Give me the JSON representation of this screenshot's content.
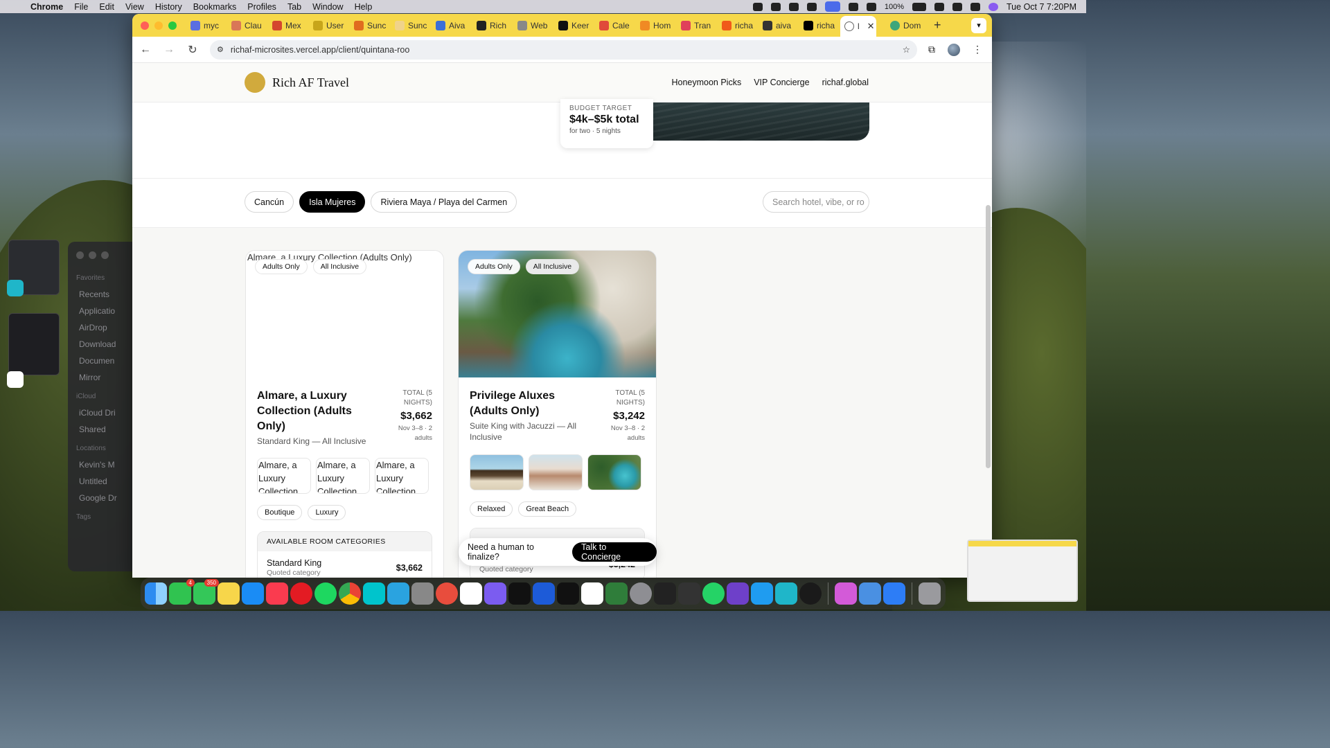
{
  "menubar": {
    "app": "Chrome",
    "items": [
      "File",
      "Edit",
      "View",
      "History",
      "Bookmarks",
      "Profiles",
      "Tab",
      "Window",
      "Help"
    ],
    "battery": "100%",
    "datetime": "Tue Oct 7  7:20PM"
  },
  "finder": {
    "favorites_label": "Favorites",
    "favorites": [
      "Recents",
      "Applicatio",
      "AirDrop",
      "Download",
      "Documen",
      "Mirror"
    ],
    "icloud_label": "iCloud",
    "icloud": [
      "iCloud Dri",
      "Shared"
    ],
    "locations_label": "Locations",
    "locations": [
      "Kevin's M",
      "Untitled",
      "Google Dr"
    ],
    "tags_label": "Tags"
  },
  "browser": {
    "tabs": [
      {
        "label": "myc",
        "color": "#5b6ee1"
      },
      {
        "label": "Clau",
        "color": "#d97757"
      },
      {
        "label": "Mex",
        "color": "#d4462e"
      },
      {
        "label": "User",
        "color": "#c7a51a"
      },
      {
        "label": "Sunc",
        "color": "#e06c1f"
      },
      {
        "label": "Sunc",
        "color": "#f0d38a"
      },
      {
        "label": "Aiva",
        "color": "#3b6fd6"
      },
      {
        "label": "Rich",
        "color": "#222222"
      },
      {
        "label": "Web",
        "color": "#888888"
      },
      {
        "label": "Keer",
        "color": "#111111"
      },
      {
        "label": "Cale",
        "color": "#e04a3a"
      },
      {
        "label": "Hom",
        "color": "#f08a24"
      },
      {
        "label": "Tran",
        "color": "#e0405a"
      },
      {
        "label": "richa",
        "color": "#f05a1a"
      },
      {
        "label": "aiva",
        "color": "#333333"
      },
      {
        "label": "richa",
        "color": "#000000"
      }
    ],
    "active_tab": {
      "label": "l",
      "close": "✕"
    },
    "last_tab": {
      "label": "Dom",
      "color": "#3fa67a"
    },
    "new_tab": "+",
    "url": "richaf-microsites.vercel.app/client/quintana-roo"
  },
  "site": {
    "brand": "Rich AF Travel",
    "nav": [
      "Honeymoon Picks",
      "VIP Concierge",
      "richaf.global"
    ],
    "budget": {
      "label": "BUDGET TARGET",
      "value": "$4k–$5k total",
      "sub": "for two · 5 nights"
    },
    "regions": [
      {
        "label": "Cancún",
        "active": false
      },
      {
        "label": "Isla Mujeres",
        "active": true
      },
      {
        "label": "Riviera Maya / Playa del Carmen",
        "active": false
      }
    ],
    "search_placeholder": "Search hotel, vibe, or ro",
    "hotels": [
      {
        "image_alt": "Almare, a Luxury Collection (Adults Only)",
        "tags": [
          "Adults Only",
          "All Inclusive"
        ],
        "name": "Almare, a Luxury Collection (Adults Only)",
        "room": "Standard King — All Inclusive",
        "price_label": "TOTAL (5 NIGHTS)",
        "price": "$3,662",
        "price_sub": "Nov 3–8 · 2 adults",
        "thumb_alts": [
          "Almare, a Luxury Collection",
          "Almare, a Luxury Collection",
          "Almare, a Luxury Collection"
        ],
        "chips": [
          "Boutique",
          "Luxury"
        ],
        "rooms_header": "AVAILABLE ROOM CATEGORIES",
        "room_row": {
          "name": "Standard King",
          "sub": "Quoted category",
          "price": "$3,662"
        }
      },
      {
        "tags": [
          "Adults Only",
          "All Inclusive"
        ],
        "name": "Privilege Aluxes (Adults Only)",
        "room": "Suite King with Jacuzzi — All Inclusive",
        "price_label": "TOTAL (5 NIGHTS)",
        "price": "$3,242",
        "price_sub": "Nov 3–8 · 2 adults",
        "chips": [
          "Relaxed",
          "Great Beach"
        ],
        "room_row": {
          "sub": "Quoted category",
          "price": "$3,242"
        }
      }
    ],
    "cta": {
      "text": "Need a human to finalize?",
      "button": "Talk to Concierge"
    }
  },
  "dock": {
    "messages_badge": "4",
    "chat_badge": "350"
  }
}
